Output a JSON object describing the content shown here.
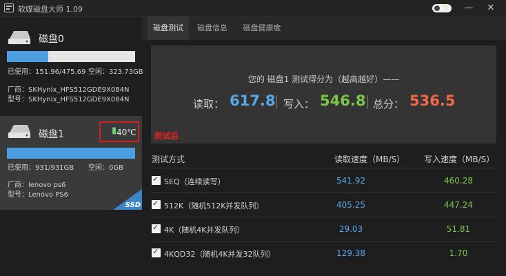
{
  "app": {
    "title": "软媒磁盘大师 1.09"
  },
  "tabs": [
    {
      "label": "磁盘测试",
      "active": true
    },
    {
      "label": "磁盘信息",
      "active": false
    },
    {
      "label": "磁盘健康度",
      "active": false
    }
  ],
  "disks": [
    {
      "name": "磁盘0",
      "used_label": "已使用：151.96/475.69",
      "free_label": "空闲：323.73GB",
      "usage_fraction": 0.32,
      "vendor_label": "厂商：SKHynix_HFS512GDE9X084N",
      "model_label": "型号：SKHynix_HFS512GDE9X084N",
      "selected": false
    },
    {
      "name": "磁盘1",
      "used_label": "已使用：931/931GB",
      "free_label": "空闲：0GB",
      "usage_fraction": 1.0,
      "vendor_label": "厂商：lenovo ps6",
      "model_label": "型号：Lenovo PS6",
      "temperature": "40℃",
      "badge": "SSD",
      "selected": true
    }
  ],
  "annotation": "测试后",
  "score": {
    "caption": "您的 磁盘1 测试得分为（越高越好）——",
    "read_label": "读取：",
    "read_value": "617.8",
    "write_label": "写入：",
    "write_value": "546.8",
    "total_label": "总分：",
    "total_value": "536.5"
  },
  "table": {
    "headers": {
      "method": "测试方式",
      "read": "读取速度（MB/S）",
      "write": "写入速度（MB/S）"
    },
    "rows": [
      {
        "name": "SEQ（连续读写）",
        "read": "541.92",
        "write": "460.28",
        "checked": true
      },
      {
        "name": "512K（随机512K并发队列）",
        "read": "405.25",
        "write": "447.24",
        "checked": true
      },
      {
        "name": "4K（随机4K并发队列）",
        "read": "29.03",
        "write": "51.81",
        "checked": true
      },
      {
        "name": "4KQD32（随机4K并发32队列）",
        "read": "129.38",
        "write": "1.70",
        "checked": true
      }
    ]
  },
  "colors": {
    "read": "#5aa8ea",
    "write": "#7bc848",
    "total": "#f06a4a",
    "bar_fill": "#4d9ee0",
    "highlight_box": "#d22020"
  }
}
